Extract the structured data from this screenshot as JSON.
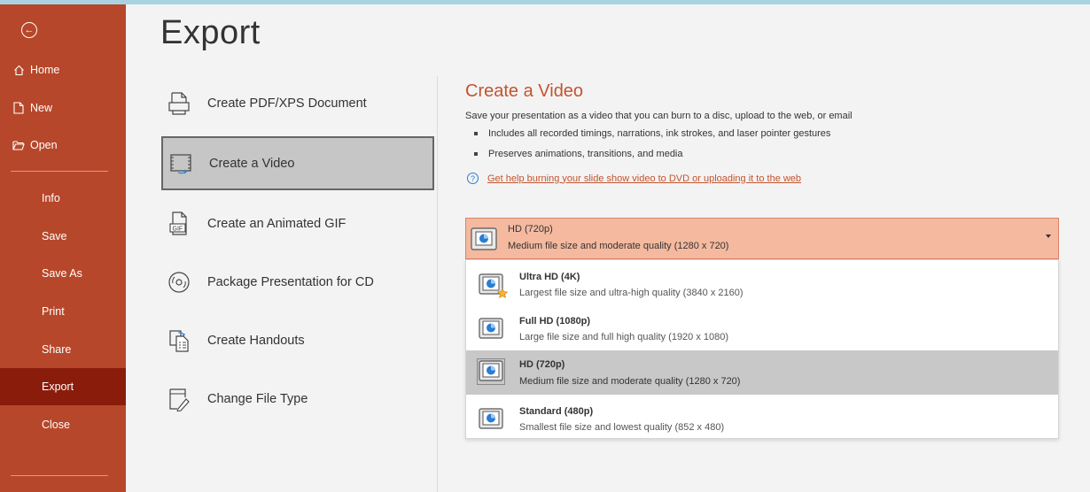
{
  "sidebar": {
    "items": [
      {
        "label": "Home",
        "icon": "home-icon"
      },
      {
        "label": "New",
        "icon": "new-file-icon"
      },
      {
        "label": "Open",
        "icon": "folder-open-icon"
      },
      {
        "label": "Info"
      },
      {
        "label": "Save"
      },
      {
        "label": "Save As"
      },
      {
        "label": "Print"
      },
      {
        "label": "Share"
      },
      {
        "label": "Export"
      },
      {
        "label": "Close"
      }
    ],
    "active": "Export"
  },
  "page": {
    "title": "Export"
  },
  "export_options": [
    {
      "label": "Create PDF/XPS Document",
      "icon": "pdf-document-icon"
    },
    {
      "label": "Create a Video",
      "icon": "video-icon"
    },
    {
      "label": "Create an Animated GIF",
      "icon": "gif-icon"
    },
    {
      "label": "Package Presentation for CD",
      "icon": "cd-icon"
    },
    {
      "label": "Create Handouts",
      "icon": "handouts-icon"
    },
    {
      "label": "Change File Type",
      "icon": "change-file-type-icon"
    }
  ],
  "selected_option": "Create a Video",
  "video": {
    "title": "Create a Video",
    "description": "Save your presentation as a video that you can burn to a disc, upload to the web, or email",
    "bullets": [
      "Includes all recorded timings, narrations, ink strokes, and laser pointer gestures",
      "Preserves animations, transitions, and media"
    ],
    "help_link": "Get help burning your slide show video to DVD or uploading it to the web",
    "quality_dropdown": {
      "selected_name": "HD (720p)",
      "selected_desc": "Medium file size and moderate quality (1280 x 720)",
      "options": [
        {
          "name": "Ultra HD (4K)",
          "desc": "Largest file size and ultra-high quality (3840 x 2160)"
        },
        {
          "name": "Full HD (1080p)",
          "desc": "Large file size and full high quality (1920 x 1080)"
        },
        {
          "name": "HD (720p)",
          "desc": "Medium file size and moderate quality (1280 x 720)"
        },
        {
          "name": "Standard (480p)",
          "desc": "Smallest file size and lowest quality (852 x 480)"
        }
      ]
    }
  },
  "colors": {
    "sidebar": "#b7472a",
    "sidebar_active": "#8a1c0c",
    "accent": "#c2542f",
    "dropdown_selected": "#f4b99f"
  }
}
